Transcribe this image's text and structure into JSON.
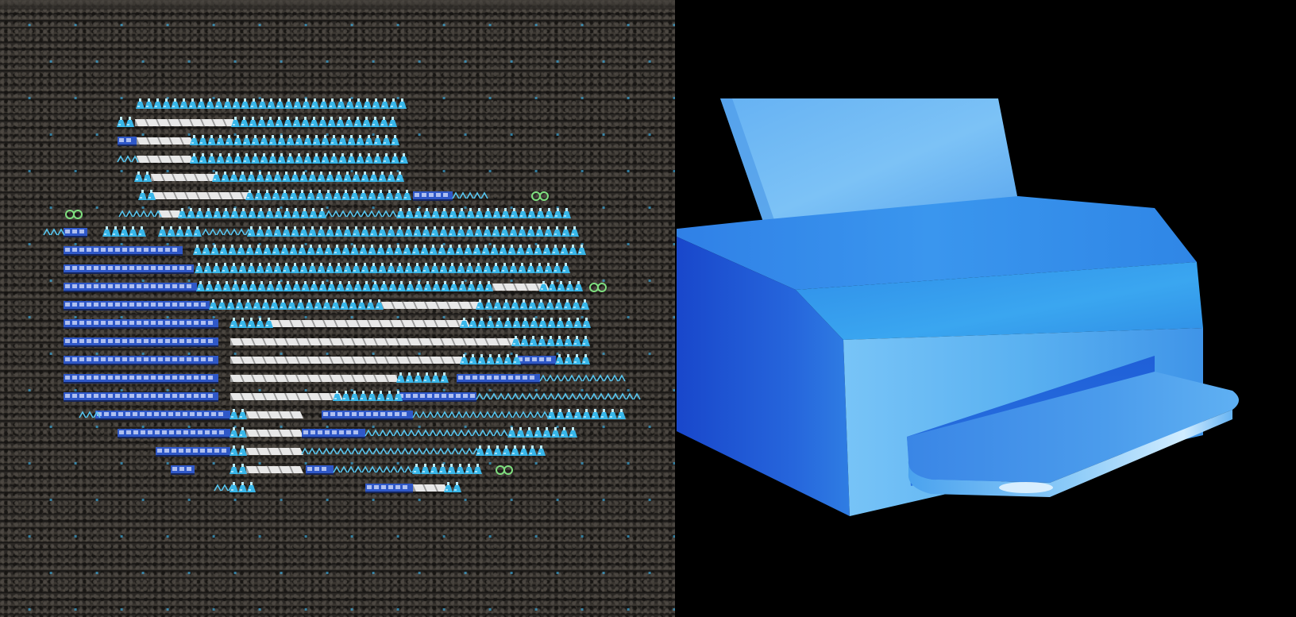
{
  "left_panel": {
    "icon": "factorio-printer-blueprint-art",
    "colors": {
      "ground": "#2a2724",
      "ground_dark": "#1c1a18",
      "flask_cyan": "#38b7ea",
      "flask_light": "#bfeeff",
      "belt_white": "#e8e8e8",
      "belt_shadow": "#9a9a9a",
      "machine_blue": "#2f58c8",
      "machine_light": "#aebff0",
      "green_accent": "#7fe07f"
    }
  },
  "right_panel": {
    "icon": "printer-3d-icon",
    "colors": {
      "background": "#000000",
      "body_side": "#1f56d6",
      "body_front": "#5aaff0",
      "body_top": "#3f9cec",
      "paper": "#72bdf2",
      "tray": "#3f8fe6",
      "highlight": "#bfe4ff"
    }
  }
}
